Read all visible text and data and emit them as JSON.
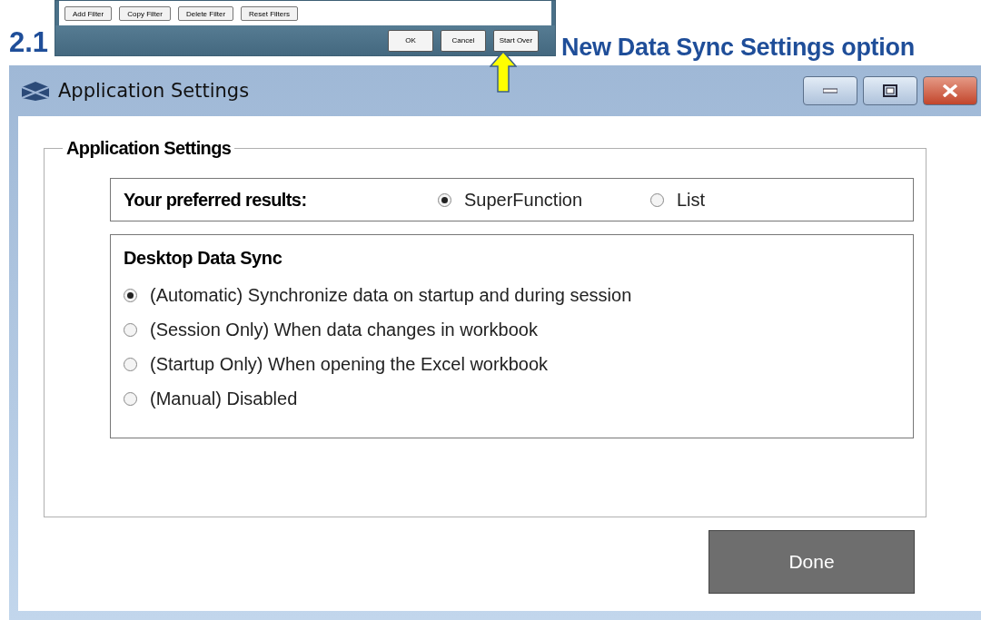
{
  "heading": {
    "number": "2.1",
    "title": "New Data Sync Settings option"
  },
  "embedded_screenshot": {
    "filter_buttons": [
      "Add Filter",
      "Copy Filter",
      "Delete Filter",
      "Reset Filters"
    ],
    "dialog_buttons": [
      "OK",
      "Cancel",
      "Start Over"
    ]
  },
  "window": {
    "title": "Application Settings",
    "group_title": "Application Settings",
    "preferred_results": {
      "label": "Your preferred results:",
      "options": [
        {
          "label": "SuperFunction",
          "selected": true
        },
        {
          "label": "List",
          "selected": false
        }
      ]
    },
    "data_sync": {
      "title": "Desktop Data Sync",
      "options": [
        {
          "label": "(Automatic) Synchronize data on startup and during session",
          "selected": true
        },
        {
          "label": "(Session Only) When data changes in workbook",
          "selected": false
        },
        {
          "label": "(Startup Only) When opening the Excel workbook",
          "selected": false
        },
        {
          "label": "(Manual) Disabled",
          "selected": false
        }
      ]
    },
    "done_button": "Done"
  }
}
